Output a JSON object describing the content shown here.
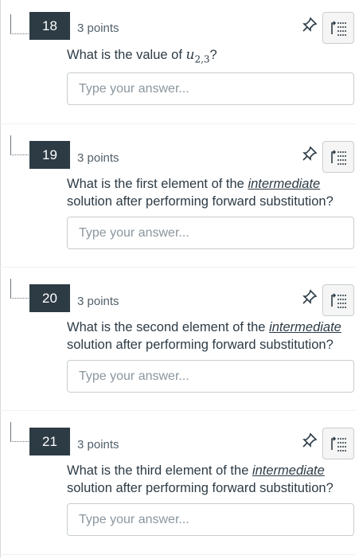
{
  "questions": [
    {
      "number": "18",
      "points": "3 points",
      "text_prefix": "What is the value of ",
      "math_var": "u",
      "math_sub": "2,3",
      "text_suffix": "?",
      "placeholder": "Type your answer..."
    },
    {
      "number": "19",
      "points": "3 points",
      "line1_prefix": "What is the first element of the ",
      "emphasis": "intermediate",
      "line2": "solution after performing forward substitution?",
      "placeholder": "Type your answer..."
    },
    {
      "number": "20",
      "points": "3 points",
      "line1_prefix": "What is the second element of the ",
      "emphasis": "intermediate",
      "line2": "solution after performing forward substitution?",
      "placeholder": "Type your answer..."
    },
    {
      "number": "21",
      "points": "3 points",
      "line1_prefix": "What is the third element of the ",
      "emphasis": "intermediate",
      "line2": "solution after performing forward substitution?",
      "placeholder": "Type your answer..."
    }
  ],
  "icons": {
    "pin": "pin-icon",
    "list": "list-icon"
  },
  "colors": {
    "number_badge": "#2d3b45",
    "text": "#2d3b45",
    "border": "#c7cdd1"
  }
}
